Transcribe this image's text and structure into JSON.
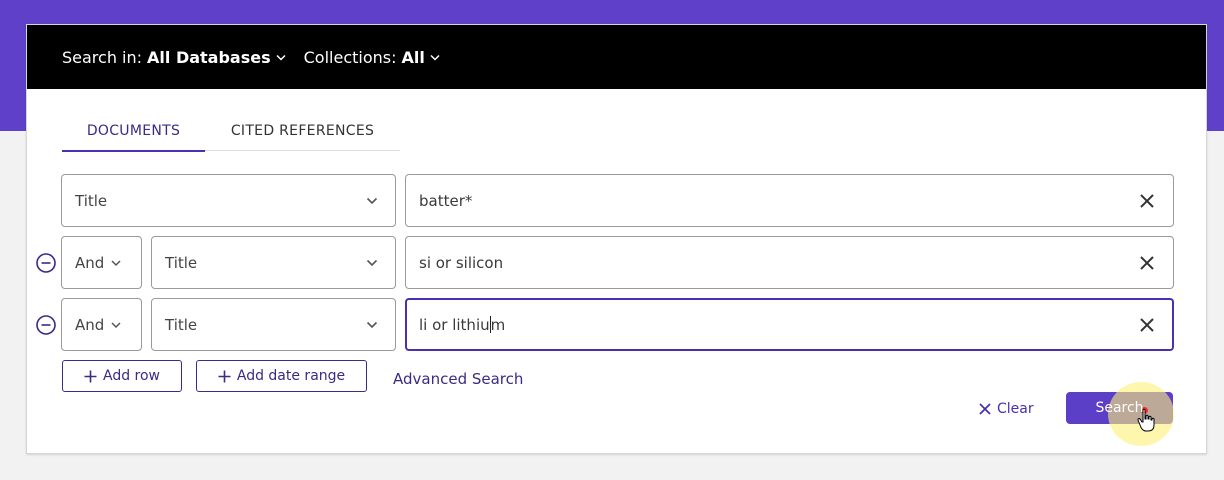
{
  "header": {
    "search_in_label": "Search in:",
    "search_in_value": "All Databases",
    "collections_label": "Collections:",
    "collections_value": "All"
  },
  "tabs": [
    {
      "label": "DOCUMENTS",
      "active": true
    },
    {
      "label": "CITED REFERENCES",
      "active": false
    }
  ],
  "rows": [
    {
      "field": "Title",
      "value": "batter*"
    },
    {
      "operator": "And",
      "field": "Title",
      "value": "si or silicon"
    },
    {
      "operator": "And",
      "field": "Title",
      "value_before_caret": "li or lithiu",
      "value_after_caret": "m",
      "active": true
    }
  ],
  "actions": {
    "add_row": "Add row",
    "add_date_range": "Add date range",
    "advanced_search": "Advanced Search",
    "clear": "Clear",
    "search": "Search"
  },
  "colors": {
    "brand_purple": "#5e41c8",
    "button_purple": "#5b3fc6",
    "link_purple": "#3b2a86"
  },
  "icons": [
    "chevron-down-icon",
    "close-icon",
    "remove-circle-icon",
    "plus-icon",
    "pointer-cursor-icon"
  ]
}
